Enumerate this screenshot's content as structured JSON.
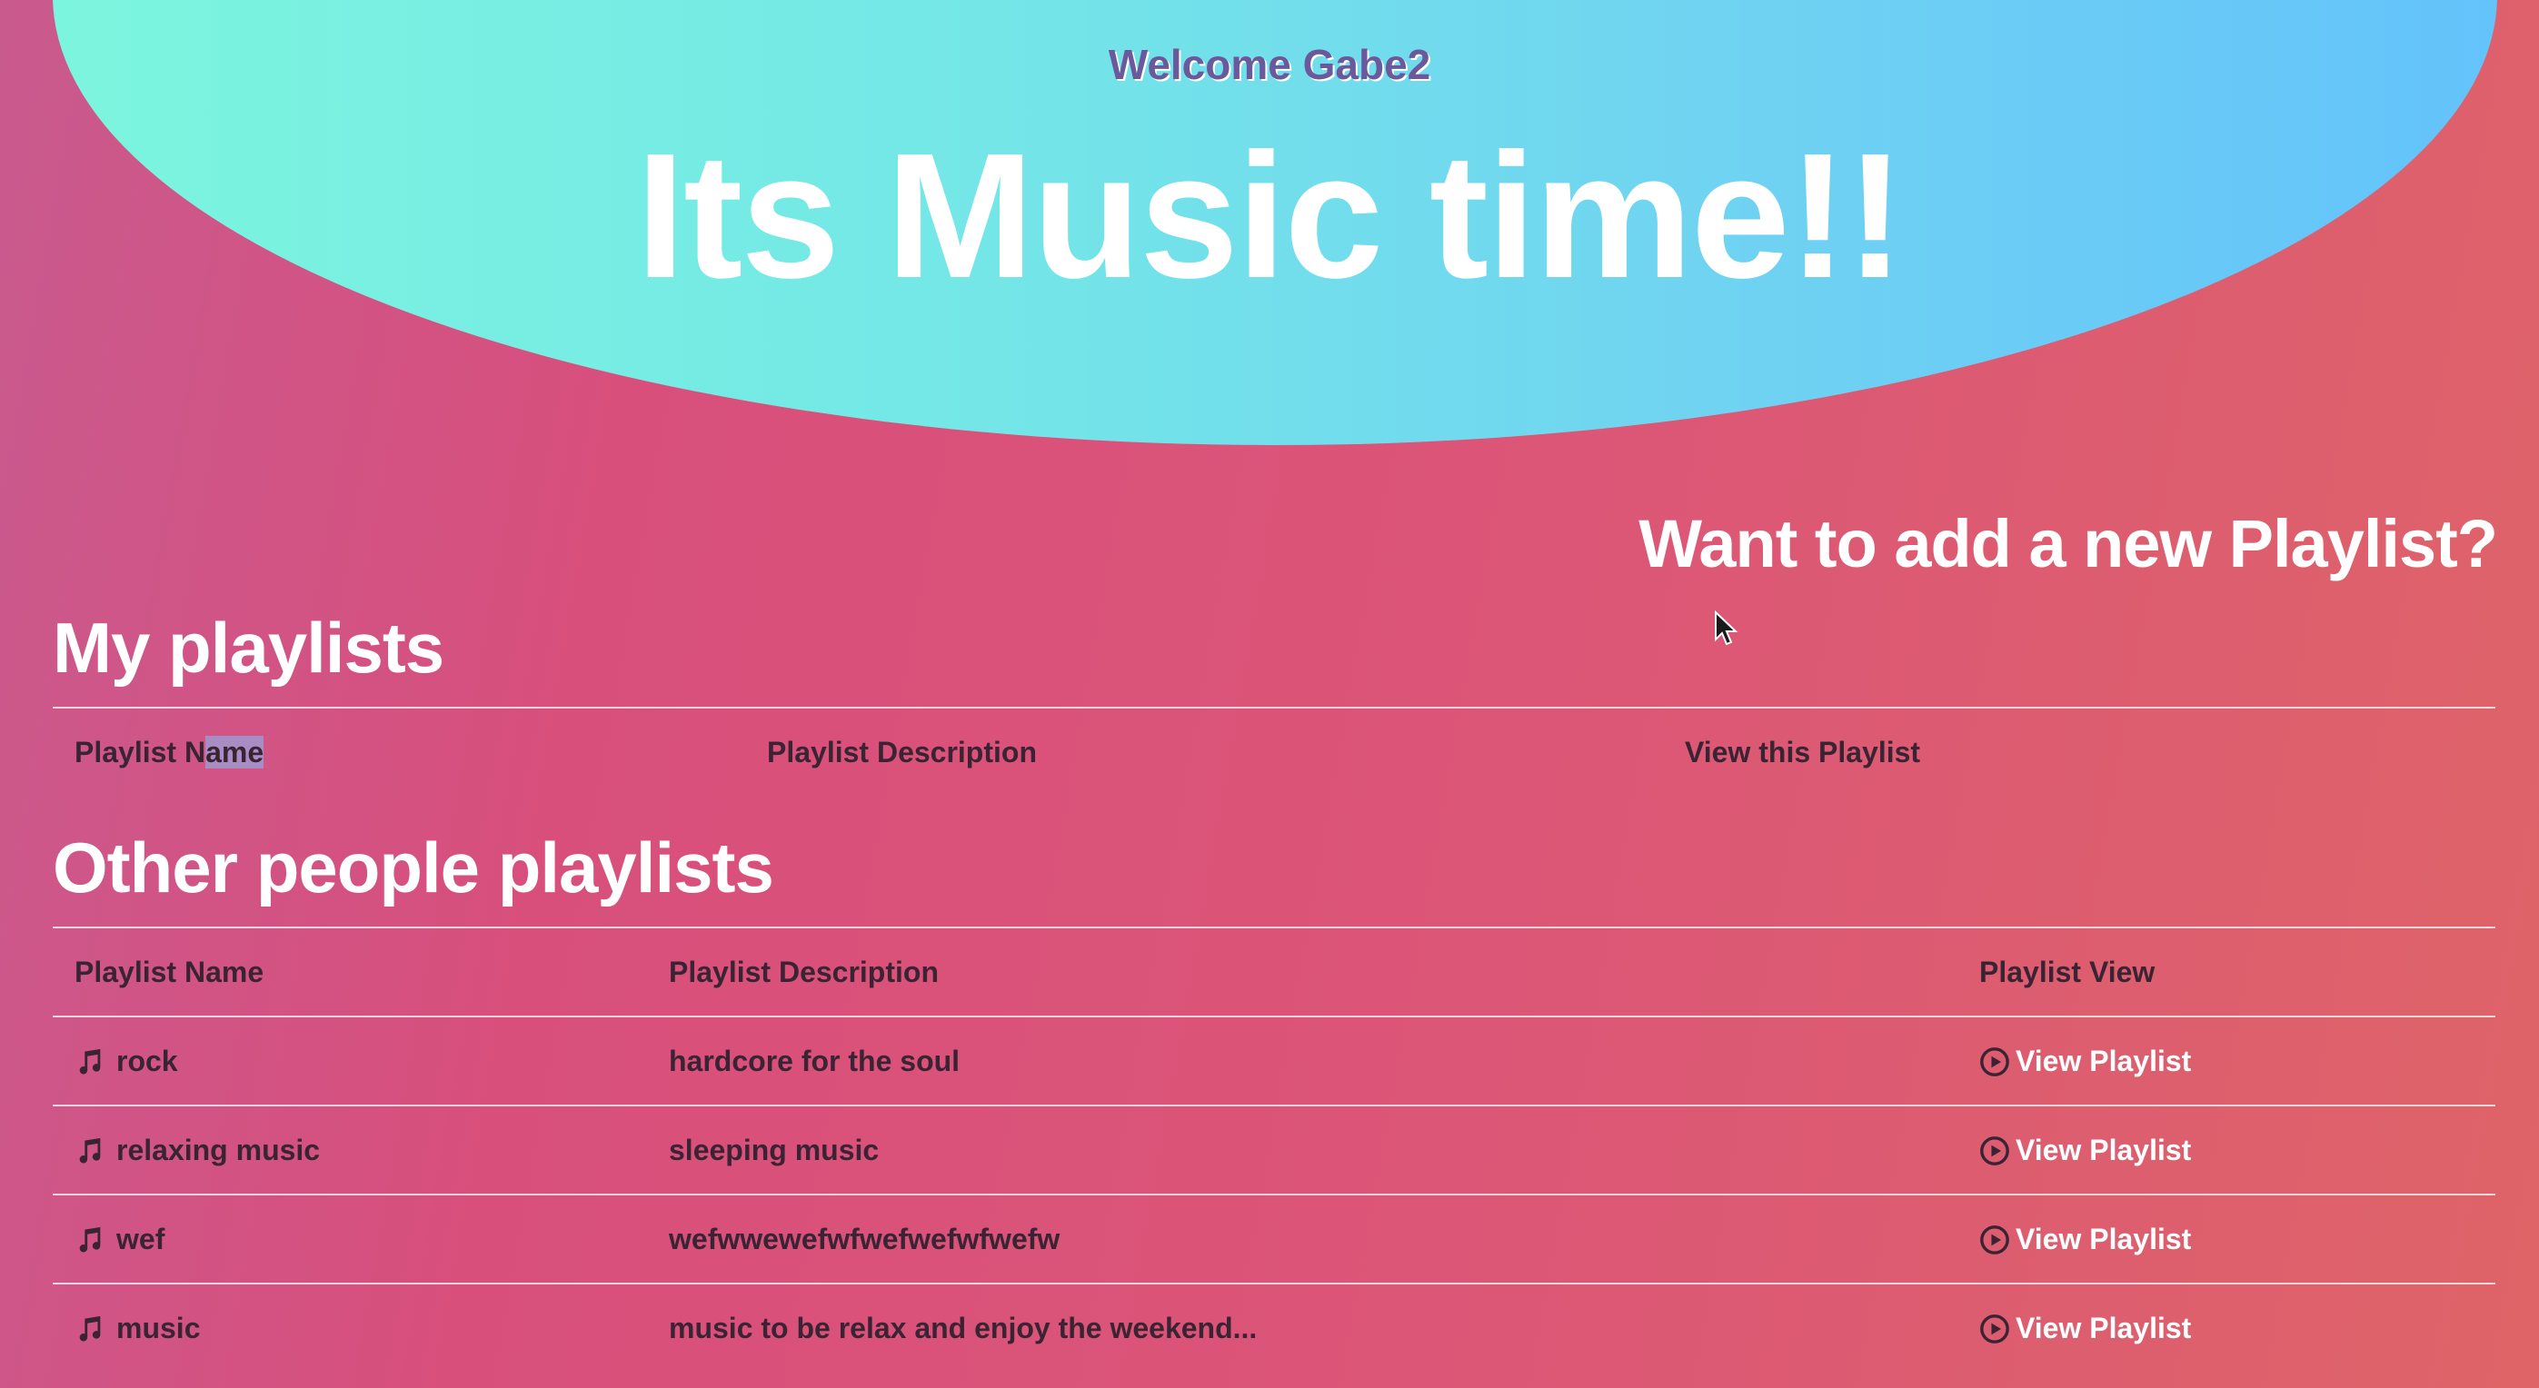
{
  "header": {
    "welcome": "Welcome Gabe2",
    "title": "Its Music time!!"
  },
  "add_playlist": {
    "label": "Want to add a new Playlist?"
  },
  "my_playlists": {
    "title": "My playlists",
    "columns": {
      "name_prefix": "Playlist N",
      "name_highlight": "ame",
      "description": "Playlist Description",
      "view": "View this Playlist"
    }
  },
  "other_playlists": {
    "title": "Other people playlists",
    "columns": {
      "name": "Playlist Name",
      "description": "Playlist Description",
      "view": "Playlist View"
    },
    "rows": [
      {
        "name": "rock",
        "description": "hardcore for the soul",
        "view_label": "View Playlist"
      },
      {
        "name": "relaxing music",
        "description": "sleeping music",
        "view_label": "View Playlist"
      },
      {
        "name": "wef",
        "description": "wefwwewefwfwefwefwfwefw",
        "view_label": "View Playlist"
      },
      {
        "name": "music",
        "description": "music to be relax and enjoy the weekend...",
        "view_label": "View Playlist"
      }
    ]
  },
  "icons": {
    "row_icon": "music-note-icon",
    "view_icon": "play-circle-icon"
  },
  "colors": {
    "hero_start": "#7cf5de",
    "hero_end": "#63c3fb",
    "background_start": "#c95a8e",
    "background_end": "#de6468",
    "welcome_text": "#6a5a9c",
    "table_text": "#3a2433",
    "selection_highlight": "#a88cc4"
  }
}
